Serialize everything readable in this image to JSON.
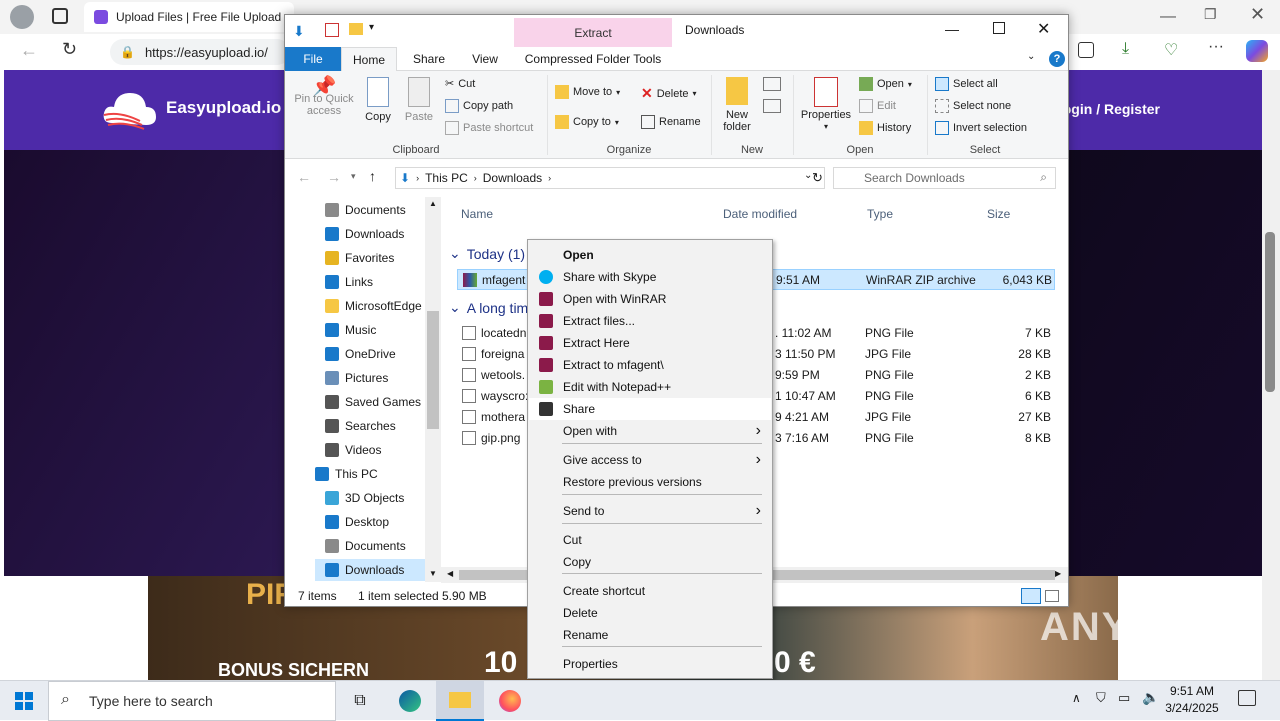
{
  "browser": {
    "tab_title": "Upload Files | Free File Upload a",
    "url": "https://easyupload.io/",
    "site_brand": "Easyupload.io",
    "login_register": "Login / Register",
    "banner_text_left": "PIRATE",
    "banner_text_bottom": "BONUS SICHERN",
    "banner_amount": "10",
    "banner_euro": "0 €"
  },
  "explorer": {
    "qat_title": "Downloads",
    "context_tab_label": "Extract",
    "context_tab_sub": "Compressed Folder Tools",
    "tabs": [
      "File",
      "Home",
      "Share",
      "View"
    ],
    "ribbon": {
      "clipboard": {
        "pin": "Pin to Quick access",
        "copy": "Copy",
        "paste": "Paste",
        "cut": "Cut",
        "copy_path": "Copy path",
        "paste_shortcut": "Paste shortcut",
        "label": "Clipboard"
      },
      "organize": {
        "move_to": "Move to",
        "copy_to": "Copy to",
        "delete": "Delete",
        "rename": "Rename",
        "label": "Organize"
      },
      "new": {
        "new_folder": "New folder",
        "label": "New"
      },
      "open": {
        "properties": "Properties",
        "open": "Open",
        "edit": "Edit",
        "history": "History",
        "label": "Open"
      },
      "select": {
        "select_all": "Select all",
        "select_none": "Select none",
        "invert": "Invert selection",
        "label": "Select"
      }
    },
    "path": [
      "This PC",
      "Downloads"
    ],
    "search_placeholder": "Search Downloads",
    "nav_items": [
      {
        "label": "Documents",
        "icon": "documents-icon"
      },
      {
        "label": "Downloads",
        "icon": "downloads-icon"
      },
      {
        "label": "Favorites",
        "icon": "star-icon"
      },
      {
        "label": "Links",
        "icon": "links-icon"
      },
      {
        "label": "MicrosoftEdge",
        "icon": "folder-icon"
      },
      {
        "label": "Music",
        "icon": "music-icon"
      },
      {
        "label": "OneDrive",
        "icon": "cloud-icon"
      },
      {
        "label": "Pictures",
        "icon": "pictures-icon"
      },
      {
        "label": "Saved Games",
        "icon": "games-icon"
      },
      {
        "label": "Searches",
        "icon": "search-icon"
      },
      {
        "label": "Videos",
        "icon": "videos-icon"
      },
      {
        "label": "This PC",
        "icon": "pc-icon"
      },
      {
        "label": "3D Objects",
        "icon": "cube-icon"
      },
      {
        "label": "Desktop",
        "icon": "desktop-icon"
      },
      {
        "label": "Documents",
        "icon": "documents-icon"
      },
      {
        "label": "Downloads",
        "icon": "downloads-icon"
      }
    ],
    "columns": [
      "Name",
      "Date modified",
      "Type",
      "Size"
    ],
    "groups": [
      {
        "label": "Today (1)",
        "files": [
          {
            "name": "mfagent",
            "date": "9:51 AM",
            "type": "WinRAR ZIP archive",
            "size": "6,043 KB"
          }
        ]
      },
      {
        "label": "A long tim",
        "files": [
          {
            "name": "locatedn",
            "date": ". 11:02 AM",
            "type": "PNG File",
            "size": "7 KB"
          },
          {
            "name": "foreigna",
            "date": "3 11:50 PM",
            "type": "JPG File",
            "size": "28 KB"
          },
          {
            "name": "wetools.",
            "date": "9:59 PM",
            "type": "PNG File",
            "size": "2 KB"
          },
          {
            "name": "wayscro:",
            "date": "1 10:47 AM",
            "type": "PNG File",
            "size": "6 KB"
          },
          {
            "name": "mothera",
            "date": "9 4:21 AM",
            "type": "JPG File",
            "size": "27 KB"
          },
          {
            "name": "gip.png",
            "date": "3 7:16 AM",
            "type": "PNG File",
            "size": "8 KB"
          }
        ]
      }
    ],
    "status": {
      "items": "7 items",
      "selected": "1 item selected",
      "size": "5.90 MB"
    }
  },
  "context_menu": [
    {
      "label": "Open",
      "bold": true,
      "icon": ""
    },
    {
      "label": "Share with Skype",
      "icon": "skype-icon"
    },
    {
      "label": "Open with WinRAR",
      "icon": "winrar-icon"
    },
    {
      "label": "Extract files...",
      "icon": "winrar-icon"
    },
    {
      "label": "Extract Here",
      "icon": "winrar-icon"
    },
    {
      "label": "Extract to mfagent\\",
      "icon": "winrar-icon"
    },
    {
      "label": "Edit with Notepad++",
      "icon": "notepadpp-icon"
    },
    {
      "label": "Share",
      "icon": "share-icon"
    },
    {
      "label": "Open with",
      "submenu": true
    },
    {
      "label": "Give access to",
      "submenu": true
    },
    {
      "label": "Restore previous versions"
    },
    {
      "label": "Send to",
      "submenu": true
    },
    {
      "label": "Cut"
    },
    {
      "label": "Copy"
    },
    {
      "label": "Create shortcut"
    },
    {
      "label": "Delete"
    },
    {
      "label": "Rename"
    },
    {
      "label": "Properties"
    }
  ],
  "taskbar": {
    "search_placeholder": "Type here to search",
    "time": "9:51 AM",
    "date": "3/24/2025"
  },
  "watermark": "ANY RUN",
  "colors": {
    "site_header": "#4d2aa8",
    "ribbon_file_tab": "#1979ca",
    "context_tab": "#f9d3ea",
    "selection": "#cce8ff"
  }
}
